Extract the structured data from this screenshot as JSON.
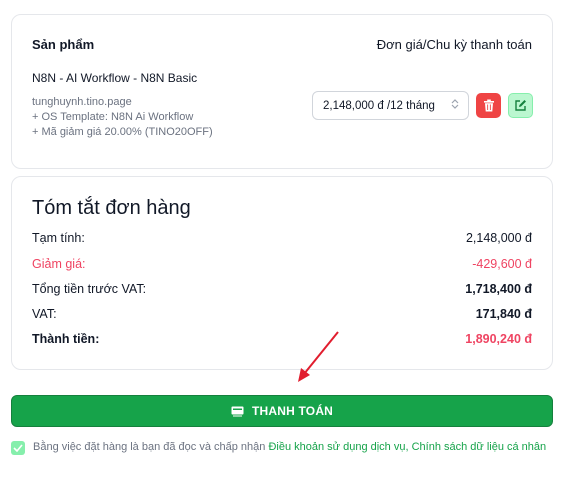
{
  "product_table": {
    "header_product": "Sản phẩm",
    "header_price": "Đơn giá/Chu kỳ thanh toán",
    "item": {
      "name": "N8N - AI Workflow - N8N Basic",
      "domain": "tunghuynh.tino.page",
      "os_template": "+ OS Template: N8N Ai Workflow",
      "discount_code": "+ Mã giảm giá 20.00% (TINO20OFF)",
      "billing_cycle": "2,148,000 đ /12 tháng"
    }
  },
  "summary": {
    "title": "Tóm tắt đơn hàng",
    "subtotal_label": "Tạm tính:",
    "subtotal_value": "2,148,000 đ",
    "discount_label": "Giảm giá:",
    "discount_value": "-429,600 đ",
    "pre_vat_label": "Tổng tiền trước VAT:",
    "pre_vat_value": "1,718,400 đ",
    "vat_label": "VAT:",
    "vat_value": "171,840 đ",
    "total_label": "Thành tiền:",
    "total_value": "1,890,240 đ"
  },
  "checkout": {
    "pay_label": "THANH TOÁN"
  },
  "terms": {
    "text": "Bằng việc đặt hàng là bạn đã đọc và chấp nhận ",
    "link_terms": "Điều khoản sử dụng dịch vụ,",
    "link_privacy": "Chính sách dữ liệu cá nhân",
    "checked": true
  },
  "colors": {
    "accent": "#16a34a",
    "danger": "#ef4444",
    "discount": "#ef4462"
  }
}
